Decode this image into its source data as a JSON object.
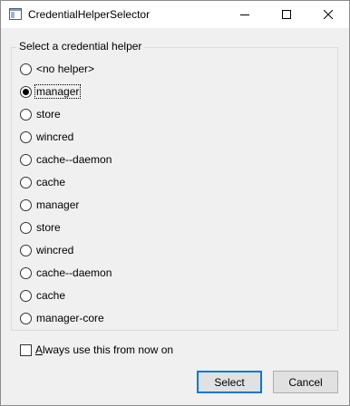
{
  "window": {
    "title": "CredentialHelperSelector",
    "icon": "app-window-icon",
    "controls": [
      "minimize-icon",
      "maximize-icon",
      "close-icon"
    ]
  },
  "group": {
    "label": "Select a credential helper",
    "options": [
      {
        "label": "<no helper>",
        "checked": false
      },
      {
        "label": "manager",
        "checked": true
      },
      {
        "label": "store",
        "checked": false
      },
      {
        "label": "wincred",
        "checked": false
      },
      {
        "label": "cache--daemon",
        "checked": false
      },
      {
        "label": "cache",
        "checked": false
      },
      {
        "label": "manager",
        "checked": false
      },
      {
        "label": "store",
        "checked": false
      },
      {
        "label": "wincred",
        "checked": false
      },
      {
        "label": "cache--daemon",
        "checked": false
      },
      {
        "label": "cache",
        "checked": false
      },
      {
        "label": "manager-core",
        "checked": false
      }
    ]
  },
  "always_use": {
    "accel": "A",
    "rest": "lways use this from now on",
    "checked": false
  },
  "buttons": {
    "select_label": "Select",
    "cancel_label": "Cancel"
  },
  "colors": {
    "accent": "#0078d7",
    "dialog_bg": "#f0f0f0",
    "button_bg": "#e1e1e1"
  }
}
